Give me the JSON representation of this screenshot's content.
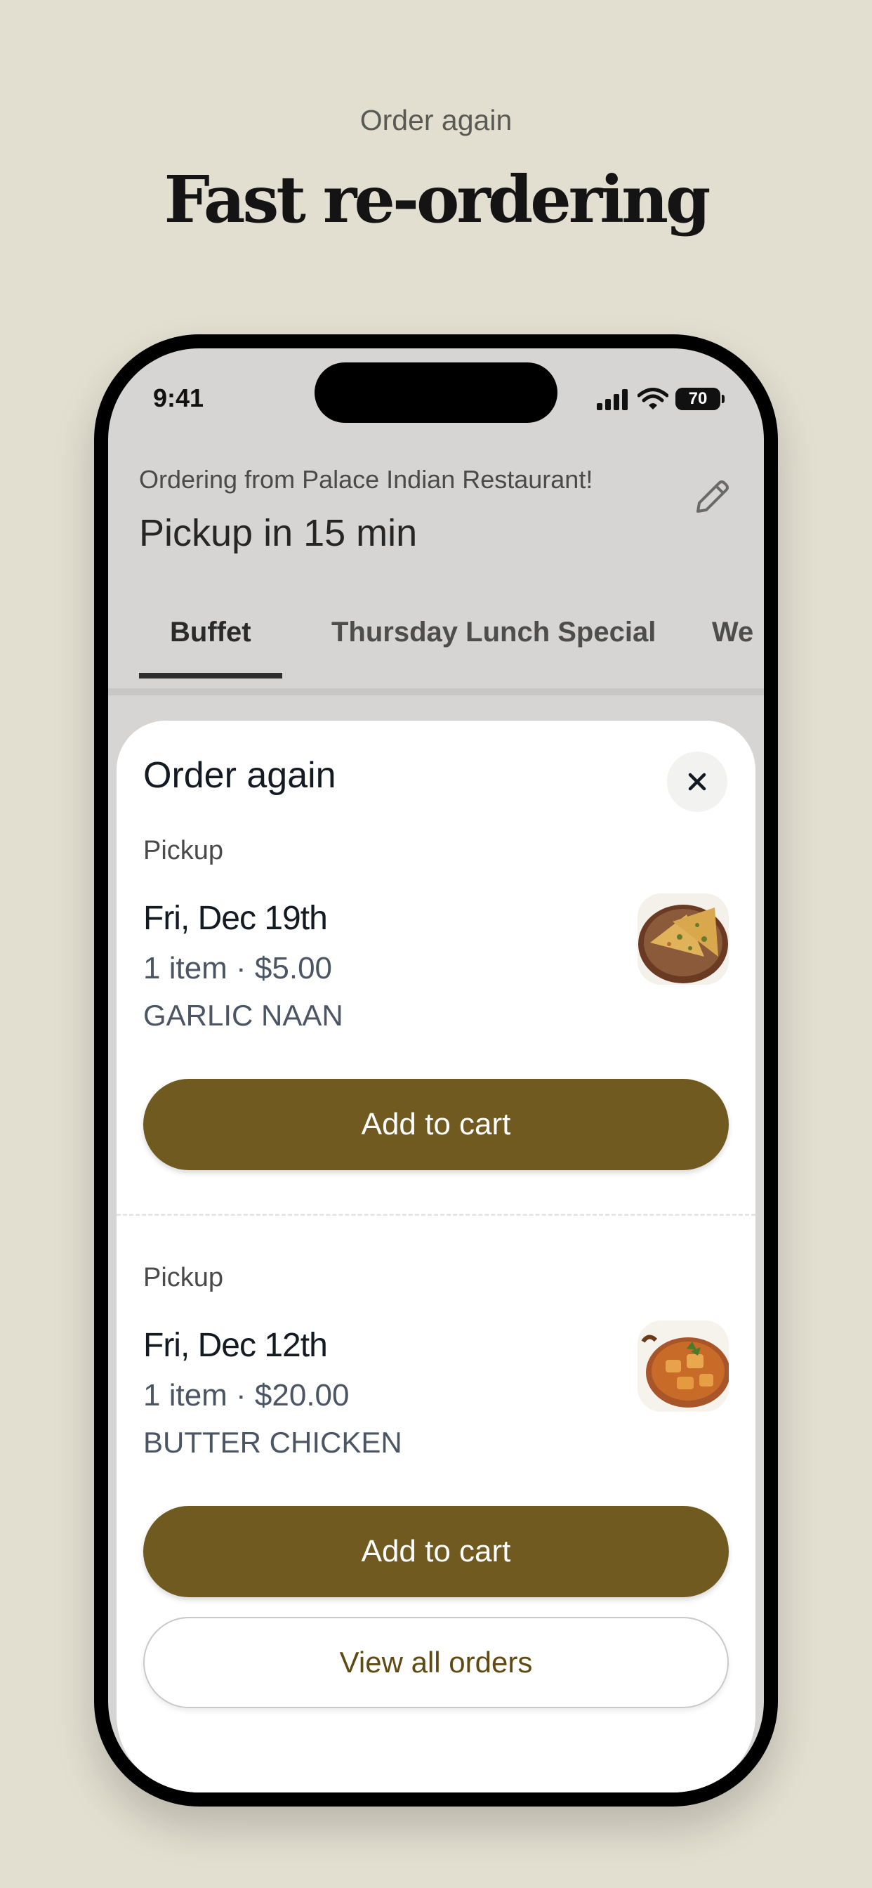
{
  "promo": {
    "eyebrow": "Order again",
    "headline": "Fast re-ordering"
  },
  "status_bar": {
    "time": "9:41",
    "battery": "70"
  },
  "header": {
    "restaurant_line": "Ordering from Palace Indian Restaurant!",
    "pickup_line": "Pickup in 15 min",
    "edit_icon": "pencil-icon"
  },
  "tabs": [
    {
      "label": "Buffet",
      "active": true
    },
    {
      "label": "Thursday Lunch Special",
      "active": false
    },
    {
      "label": "We",
      "active": false
    }
  ],
  "sheet": {
    "title": "Order again",
    "close_icon": "close-icon",
    "orders": [
      {
        "type": "Pickup",
        "date": "Fri, Dec 19th",
        "summary": "1 item · $5.00",
        "item_name": "GARLIC NAAN",
        "button_label": "Add to cart"
      },
      {
        "type": "Pickup",
        "date": "Fri, Dec 12th",
        "summary": "1 item · $20.00",
        "item_name": "BUTTER CHICKEN",
        "button_label": "Add to cart"
      }
    ],
    "view_all_label": "View all orders"
  },
  "colors": {
    "background": "#e2ded0",
    "accent": "#705a20",
    "sheet": "#ffffff"
  }
}
